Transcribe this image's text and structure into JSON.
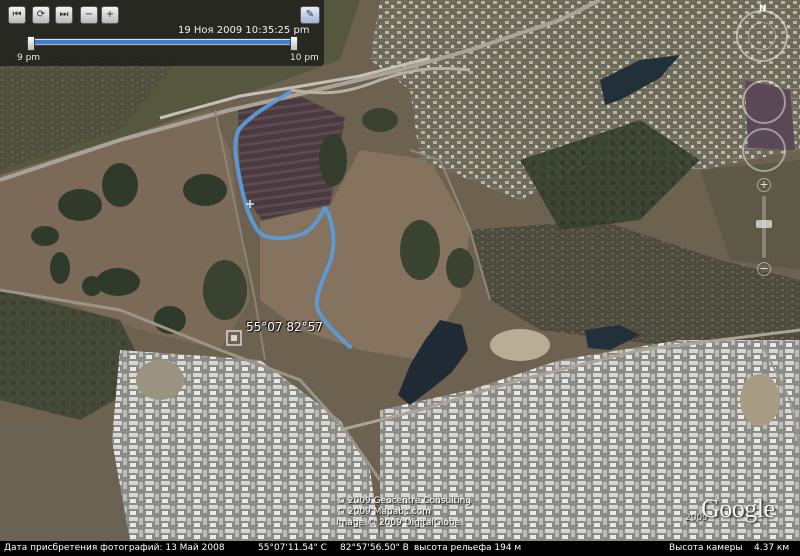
{
  "time_slider": {
    "timestamp": "19 Ноя 2009  10:35:25 pm",
    "start_label": "9 pm",
    "end_label": "10 pm",
    "buttons": [
      "first-icon",
      "clock-settings-icon",
      "next-icon",
      "zoom-out-icon",
      "zoom-in-icon",
      "wrench-icon"
    ],
    "range_fraction": [
      0.0,
      1.0
    ]
  },
  "navigation": {
    "north_label": "N",
    "zoom_plus": "+",
    "zoom_minus": "−",
    "icons": [
      "compass-ring-icon",
      "look-joystick-icon",
      "move-joystick-icon"
    ]
  },
  "map": {
    "coordinate_label": "55°07 82°57",
    "track_color": "#5b9bd8",
    "copyright_lines": [
      "© 2009 Geocentre Consulting",
      "© 2009 Mapabc.com",
      "Image © 2009 DigitalGlobe"
    ],
    "google_logo": "Google",
    "imagery_year": "2009"
  },
  "status_bar": {
    "imagery_date": "Дата присбретения фотографий: 13 Май 2008",
    "latitude": "55°07'11.54\" С",
    "longitude": "82°57'56.50\" В",
    "elevation": "высота рельефа  194 м",
    "eye_alt_label": "Высота камеры",
    "eye_alt_value": "4.37 км"
  }
}
